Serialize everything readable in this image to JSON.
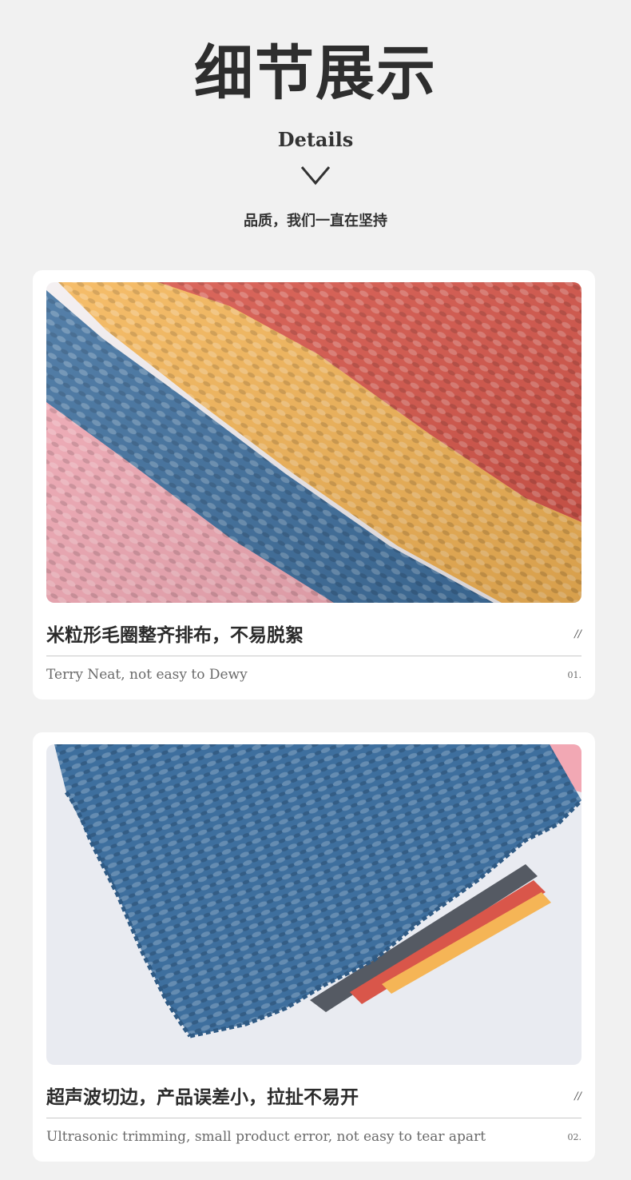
{
  "header": {
    "title": "细节展示",
    "subtitle": "Details",
    "tagline": "品质，我们一直在坚持"
  },
  "details": [
    {
      "cn_caption": "米粒形毛圈整齐排布，不易脱絮",
      "marker": "//",
      "en_caption": "Terry Neat, not easy to Dewy",
      "number": "01."
    },
    {
      "cn_caption": "超声波切边，产品误差小，拉扯不易开",
      "marker": "//",
      "en_caption": "Ultrasonic trimming, small product error, not easy to tear apart",
      "number": "02."
    }
  ],
  "colors": {
    "background": "#f1f1f1",
    "card": "#ffffff",
    "cloth_red": "#d9564a",
    "cloth_yellow": "#f5b556",
    "cloth_blue": "#3e6f9e",
    "cloth_pink": "#f2a8b4"
  }
}
